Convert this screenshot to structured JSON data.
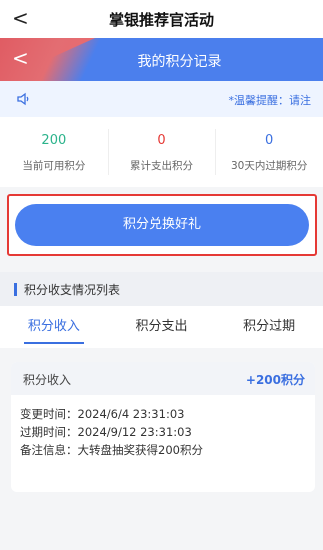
{
  "topbar": {
    "back": "<",
    "title": "掌银推荐官活动"
  },
  "banner": {
    "back": "<",
    "title": "我的积分记录"
  },
  "notice": {
    "icon": "speaker-icon",
    "text": "*温馨提醒：请注"
  },
  "stats": [
    {
      "value": "200",
      "label": "当前可用积分",
      "color": "#2bb38b"
    },
    {
      "value": "0",
      "label": "累计支出积分",
      "color": "#e53935"
    },
    {
      "value": "0",
      "label": "30天内过期积分",
      "color": "#3a6fe0"
    }
  ],
  "redeem": {
    "label": "积分兑换好礼"
  },
  "section": {
    "title": "积分收支情况列表"
  },
  "tabs": [
    {
      "label": "积分收入",
      "active": true
    },
    {
      "label": "积分支出",
      "active": false
    },
    {
      "label": "积分过期",
      "active": false
    }
  ],
  "record": {
    "type": "积分收入",
    "amount": "+200积分",
    "change_time": "变更时间：2024/6/4 23:31:03",
    "expire_time": "过期时间：2024/9/12 23:31:03",
    "note": "备注信息：大转盘抽奖获得200积分"
  }
}
